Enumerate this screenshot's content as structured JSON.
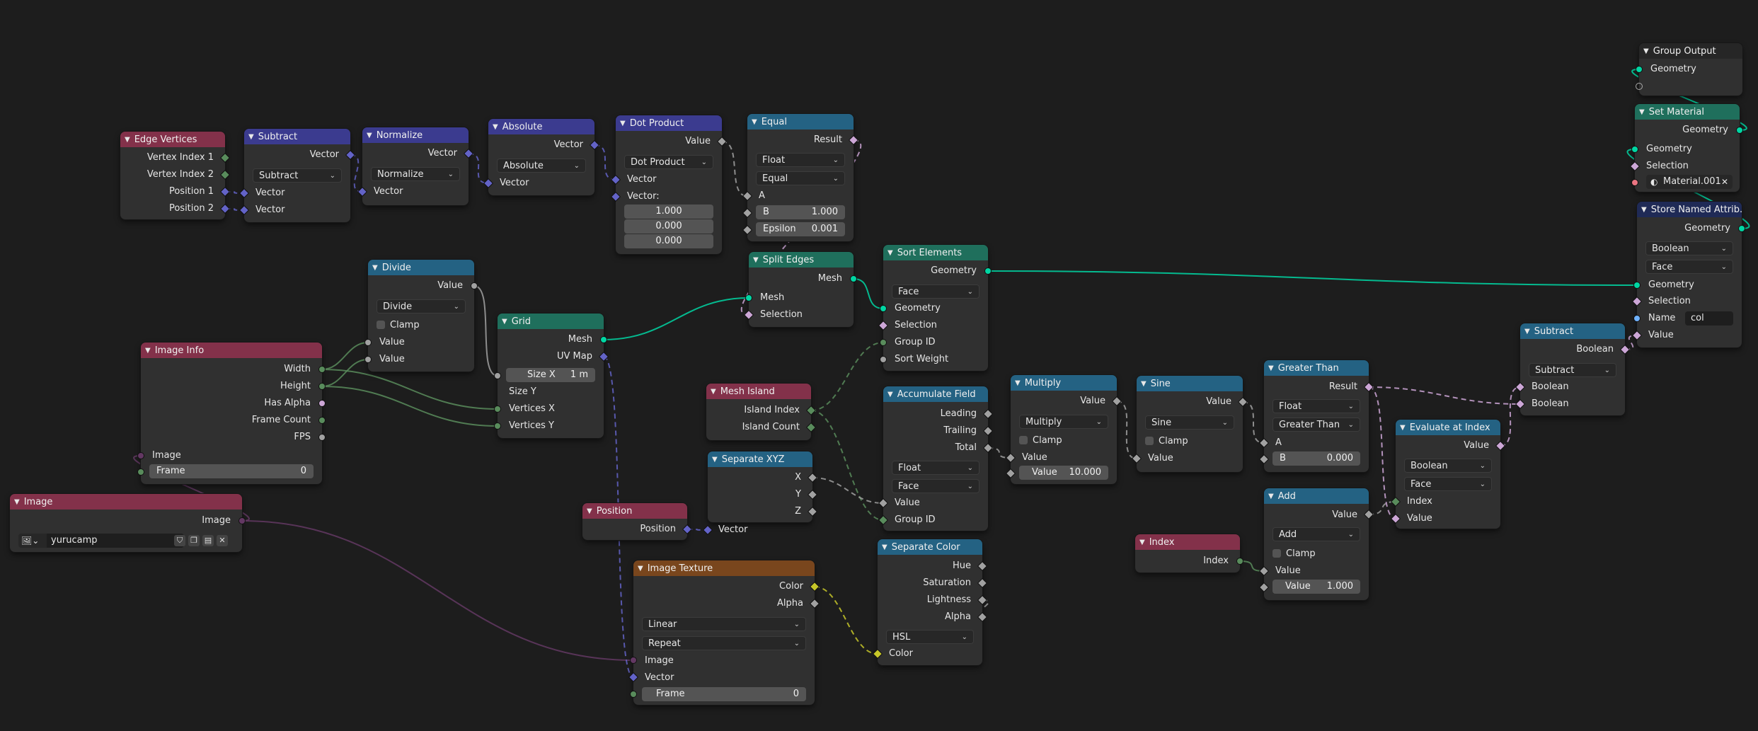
{
  "colors": {
    "header_geometry": "#1f6f5c",
    "header_vector": "#3b3b8f",
    "header_math": "#246283",
    "header_input": "#83314a",
    "header_texture": "#79461d",
    "header_attribute": "#1f2a56",
    "socket_geometry": "#00d6a3",
    "socket_vector": "#6363c7",
    "socket_float": "#a1a1a1",
    "socket_int": "#598c5c",
    "socket_bool": "#cca6d6",
    "socket_color": "#c7c729",
    "socket_image": "#633863",
    "socket_string": "#70b2ff",
    "socket_material": "#eb7582"
  },
  "nodes": {
    "edge_vertices": {
      "title": "Edge Vertices",
      "out": [
        "Vertex Index 1",
        "Vertex Index 2",
        "Position 1",
        "Position 2"
      ]
    },
    "subtract_vec": {
      "title": "Subtract",
      "out": "Vector",
      "op": "Subtract",
      "in": [
        "Vector",
        "Vector"
      ]
    },
    "normalize": {
      "title": "Normalize",
      "out": "Vector",
      "op": "Normalize",
      "in": "Vector"
    },
    "absolute": {
      "title": "Absolute",
      "out": "Vector",
      "op": "Absolute",
      "in": "Vector"
    },
    "dot_product": {
      "title": "Dot Product",
      "out": "Value",
      "op": "Dot Product",
      "in1": "Vector",
      "in2": "Vector:",
      "values": [
        "1.000",
        "0.000",
        "0.000"
      ]
    },
    "equal": {
      "title": "Equal",
      "out": "Result",
      "type": "Float",
      "op": "Equal",
      "in_a": "A",
      "b_label": "B",
      "b_value": "1.000",
      "eps_label": "Epsilon",
      "eps_value": "0.001"
    },
    "split_edges": {
      "title": "Split Edges",
      "out": "Mesh",
      "in": [
        "Mesh",
        "Selection"
      ]
    },
    "sort_elements": {
      "title": "Sort Elements",
      "out": "Geometry",
      "domain": "Face",
      "in": [
        "Geometry",
        "Selection",
        "Group ID",
        "Sort Weight"
      ]
    },
    "divide": {
      "title": "Divide",
      "out": "Value",
      "op": "Divide",
      "clamp": "Clamp",
      "in": [
        "Value",
        "Value"
      ]
    },
    "grid": {
      "title": "Grid",
      "out": [
        "Mesh",
        "UV Map"
      ],
      "size_x_label": "Size X",
      "size_x_value": "1 m",
      "in": [
        "Size Y",
        "Vertices X",
        "Vertices Y"
      ]
    },
    "image_info": {
      "title": "Image Info",
      "out": [
        "Width",
        "Height",
        "Has Alpha",
        "Frame Count",
        "FPS"
      ],
      "in_image": "Image",
      "frame_label": "Frame",
      "frame_value": "0"
    },
    "image": {
      "title": "Image",
      "out": "Image",
      "name": "yurucamp"
    },
    "mesh_island": {
      "title": "Mesh Island",
      "out": [
        "Island Index",
        "Island Count"
      ]
    },
    "separate_xyz": {
      "title": "Separate XYZ",
      "out": [
        "X",
        "Y",
        "Z"
      ]
    },
    "position": {
      "title": "Position",
      "out": "Position",
      "in": "Vector"
    },
    "image_texture": {
      "title": "Image Texture",
      "out": [
        "Color",
        "Alpha"
      ],
      "interp": "Linear",
      "ext": "Repeat",
      "in": [
        "Image",
        "Vector"
      ],
      "frame_label": "Frame",
      "frame_value": "0"
    },
    "accumulate": {
      "title": "Accumulate Field",
      "out": [
        "Leading",
        "Trailing",
        "Total"
      ],
      "type": "Float",
      "domain": "Face",
      "in": [
        "Value",
        "Group ID"
      ]
    },
    "separate_color": {
      "title": "Separate Color",
      "out": [
        "Hue",
        "Saturation",
        "Lightness",
        "Alpha"
      ],
      "mode": "HSL",
      "in": "Color"
    },
    "multiply": {
      "title": "Multiply",
      "out": "Value",
      "op": "Multiply",
      "clamp": "Clamp",
      "in": "Value",
      "value_label": "Value",
      "value": "10.000"
    },
    "sine": {
      "title": "Sine",
      "out": "Value",
      "op": "Sine",
      "clamp": "Clamp",
      "in": "Value"
    },
    "greater_than": {
      "title": "Greater Than",
      "out": "Result",
      "type": "Float",
      "op": "Greater Than",
      "in_a": "A",
      "b_label": "B",
      "b_value": "0.000"
    },
    "add": {
      "title": "Add",
      "out": "Value",
      "op": "Add",
      "clamp": "Clamp",
      "in": "Value",
      "value_label": "Value",
      "value": "1.000"
    },
    "index": {
      "title": "Index",
      "out": "Index"
    },
    "evaluate_at_index": {
      "title": "Evaluate at Index",
      "out": "Value",
      "type": "Boolean",
      "domain": "Face",
      "in": [
        "Index",
        "Value"
      ]
    },
    "subtract_math": {
      "title": "Subtract",
      "out": "Boolean",
      "op": "Subtract",
      "in": [
        "Boolean",
        "Boolean"
      ]
    },
    "group_output": {
      "title": "Group Output",
      "in": "Geometry"
    },
    "set_material": {
      "title": "Set Material",
      "out": "Geometry",
      "in": [
        "Geometry",
        "Selection"
      ],
      "material": "Material.001"
    },
    "store_named": {
      "title": "Store Named Attrib...",
      "out": "Geometry",
      "type": "Boolean",
      "domain": "Face",
      "in": [
        "Geometry",
        "Selection"
      ],
      "name_label": "Name",
      "name_value": "col",
      "value_in": "Value"
    }
  }
}
